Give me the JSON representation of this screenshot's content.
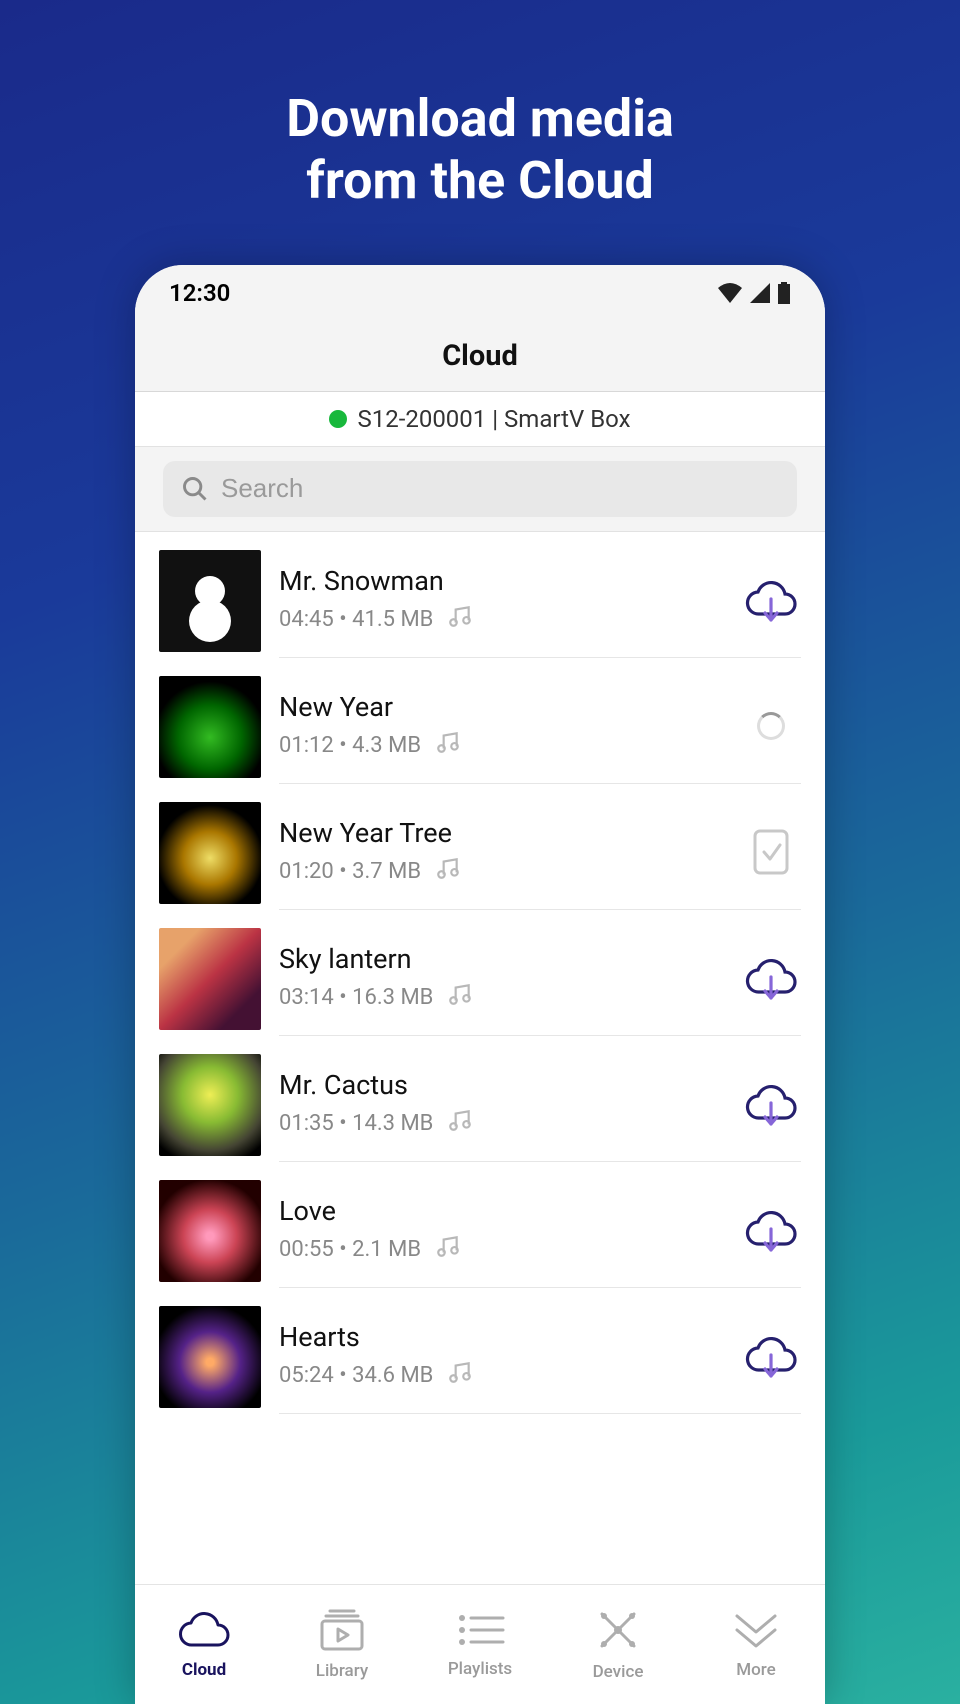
{
  "promo": {
    "line1": "Download media",
    "line2": "from the Cloud"
  },
  "status": {
    "time": "12:30"
  },
  "header": {
    "title": "Cloud"
  },
  "device": {
    "label": "S12-200001 | SmartV Box"
  },
  "search": {
    "placeholder": "Search"
  },
  "items": [
    {
      "title": "Mr. Snowman",
      "meta": "04:45 • 41.5 MB",
      "action": "download",
      "thumb": "th-snowman"
    },
    {
      "title": "New Year",
      "meta": "01:12 • 4.3 MB",
      "action": "loading",
      "thumb": "th-tree"
    },
    {
      "title": "New Year Tree",
      "meta": "01:20 • 3.7 MB",
      "action": "done",
      "thumb": "th-tree2"
    },
    {
      "title": "Sky lantern",
      "meta": "03:14 • 16.3 MB",
      "action": "download",
      "thumb": "th-lantern"
    },
    {
      "title": "Mr. Cactus",
      "meta": "01:35 • 14.3 MB",
      "action": "download",
      "thumb": "th-cactus"
    },
    {
      "title": "Love",
      "meta": "00:55 • 2.1 MB",
      "action": "download",
      "thumb": "th-love"
    },
    {
      "title": "Hearts",
      "meta": "05:24 • 34.6 MB",
      "action": "download",
      "thumb": "th-hearts"
    }
  ],
  "nav": {
    "items": [
      {
        "label": "Cloud",
        "icon": "cloud",
        "active": true
      },
      {
        "label": "Library",
        "icon": "library",
        "active": false
      },
      {
        "label": "Playlists",
        "icon": "playlist",
        "active": false
      },
      {
        "label": "Device",
        "icon": "device",
        "active": false
      },
      {
        "label": "More",
        "icon": "more",
        "active": false
      }
    ]
  }
}
